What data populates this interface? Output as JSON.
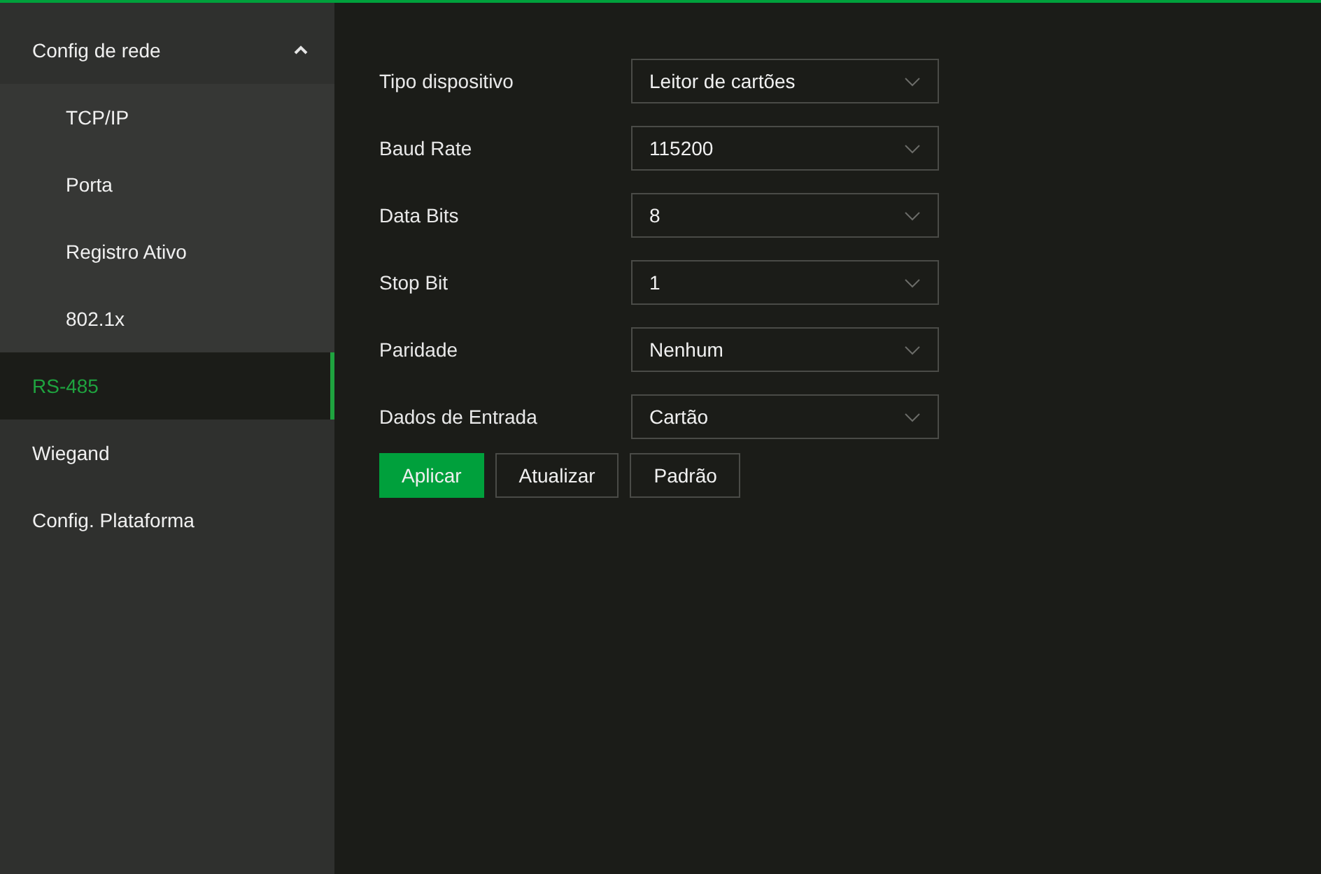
{
  "sidebar": {
    "items": [
      {
        "label": "Config de rede",
        "selected": false,
        "expanded": true,
        "children": [
          {
            "label": "TCP/IP",
            "selected": false
          },
          {
            "label": "Porta",
            "selected": false
          },
          {
            "label": "Registro Ativo",
            "selected": false
          },
          {
            "label": "802.1x",
            "selected": false
          }
        ]
      },
      {
        "label": "RS-485",
        "selected": true
      },
      {
        "label": "Wiegand",
        "selected": false
      },
      {
        "label": "Config. Plataforma",
        "selected": false
      }
    ]
  },
  "form": {
    "fields": [
      {
        "label": "Tipo dispositivo",
        "value": "Leitor de cartões"
      },
      {
        "label": "Baud Rate",
        "value": "115200"
      },
      {
        "label": "Data Bits",
        "value": "8"
      },
      {
        "label": "Stop Bit",
        "value": "1"
      },
      {
        "label": "Paridade",
        "value": "Nenhum"
      },
      {
        "label": "Dados de Entrada",
        "value": "Cartão"
      }
    ],
    "buttons": [
      {
        "label": "Aplicar",
        "kind": "primary"
      },
      {
        "label": "Atualizar",
        "kind": "secondary"
      },
      {
        "label": "Padrão",
        "kind": "secondary"
      }
    ]
  }
}
